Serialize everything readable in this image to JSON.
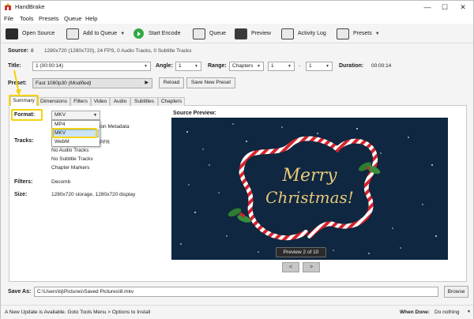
{
  "window": {
    "title": "HandBrake",
    "minimize": "—",
    "maximize": "☐",
    "close": "✕"
  },
  "menu": [
    "File",
    "Tools",
    "Presets",
    "Queue",
    "Help"
  ],
  "toolbar": {
    "open_source": "Open Source",
    "add_to_queue": "Add to Queue",
    "start_encode": "Start Encode",
    "queue": "Queue",
    "preview": "Preview",
    "activity_log": "Activity Log",
    "presets": "Presets"
  },
  "source": {
    "label": "Source:",
    "index": "8",
    "info": "1280x720 (1280x720), 24 FPS, 0 Audio Tracks, 0 Subtitle Tracks"
  },
  "title_row": {
    "title_label": "Title:",
    "title_value": "1  (00:00:14)",
    "angle_label": "Angle:",
    "angle_value": "1",
    "range_label": "Range:",
    "range_value": "Chapters",
    "range_start": "1",
    "range_sep": "-",
    "range_end": "1",
    "duration_label": "Duration:",
    "duration_value": "00:00:14"
  },
  "preset_row": {
    "label": "Preset:",
    "value": "Fast 1080p30",
    "modified": "(Modified)",
    "reload": "Reload",
    "save_new": "Save New Preset"
  },
  "tabs": [
    "Summary",
    "Dimensions",
    "Filters",
    "Video",
    "Audio",
    "Subtitles",
    "Chapters"
  ],
  "active_tab": "Summary",
  "summary": {
    "format_label": "Format:",
    "format_value": "MKV",
    "format_options": [
      "MP4",
      "MKV",
      "WebM"
    ],
    "format_selected": "MKV",
    "option_fragment_1": "ion Metadata",
    "option_fragment_2": "PFR",
    "tracks_label": "Tracks:",
    "tracks": [
      "No Audio Tracks",
      "No Subtitle Tracks",
      "Chapter Markers"
    ],
    "filters_label": "Filters:",
    "filters_value": "Decomb",
    "size_label": "Size:",
    "size_value": "1280x720 storage, 1280x720 display"
  },
  "preview": {
    "title": "Source Preview:",
    "greeting_line1": "Merry",
    "greeting_line2": "Christmas!",
    "counter": "Preview 2 of 10",
    "prev": "<",
    "next": ">"
  },
  "save_as": {
    "label": "Save As:",
    "path": "C:\\Users\\bj\\Pictures\\Saved Pictures\\8.mkv",
    "browse": "Browse"
  },
  "status": {
    "message": "A New Update is Available. Goto Tools Menu > Options to Install",
    "when_done_label": "When Done:",
    "when_done_value": "Do nothing"
  },
  "colors": {
    "highlight": "#f5d20a",
    "play_green": "#31a843",
    "preview_bg": "#0f2740",
    "greeting_gold": "#e9c97a",
    "cane_red": "#d6232a"
  }
}
